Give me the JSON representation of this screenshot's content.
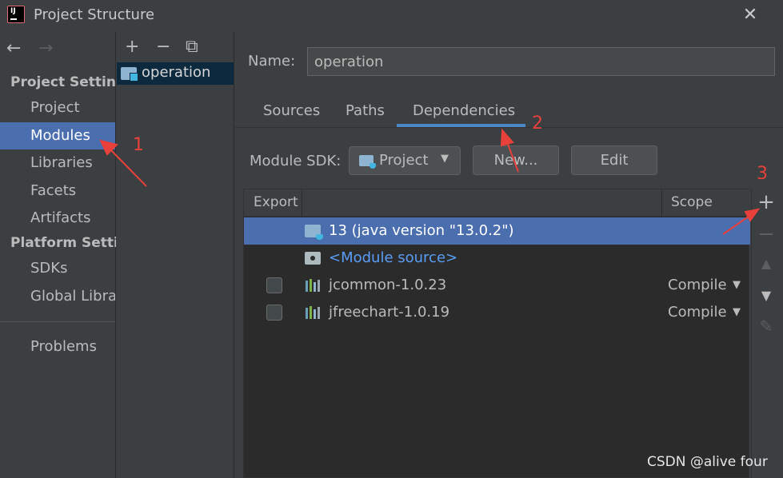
{
  "window": {
    "title": "Project Structure",
    "close_glyph": "✕"
  },
  "sidebar": {
    "back_glyph": "←",
    "forward_glyph": "→",
    "sections": [
      {
        "heading": "Project Settings",
        "items": [
          "Project",
          "Modules",
          "Libraries",
          "Facets",
          "Artifacts"
        ]
      },
      {
        "heading": "Platform Settings",
        "items": [
          "SDKs",
          "Global Libraries"
        ]
      }
    ],
    "selected": "Modules",
    "problems": "Problems"
  },
  "modules": {
    "toolbar": {
      "add_glyph": "+",
      "remove_glyph": "−",
      "copy_glyph": "⧉"
    },
    "items": [
      {
        "name": "operation",
        "selected": true
      }
    ]
  },
  "main": {
    "name_label": "Name:",
    "name_value": "operation",
    "tabs": [
      {
        "label": "Sources",
        "active": false
      },
      {
        "label": "Paths",
        "active": false
      },
      {
        "label": "Dependencies",
        "active": true
      }
    ],
    "sdk_label": "Module SDK:",
    "sdk_value": "Project SDK",
    "new_button": "New...",
    "edit_button": "Edit",
    "table": {
      "headers": {
        "export": "Export",
        "scope": "Scope"
      },
      "rows": [
        {
          "name": "13 (java version \"13.0.2\")",
          "icon": "jdk-folder-icon",
          "checkbox": false,
          "scope": "",
          "selected": true
        },
        {
          "name": "<Module source>",
          "icon": "source-folder-icon",
          "checkbox": false,
          "scope": "",
          "selected": false,
          "link": true
        },
        {
          "name": "jcommon-1.0.23",
          "icon": "library-icon",
          "checkbox": true,
          "scope": "Compile",
          "selected": false
        },
        {
          "name": "jfreechart-1.0.19",
          "icon": "library-icon",
          "checkbox": true,
          "scope": "Compile",
          "selected": false
        }
      ]
    },
    "right_toolbar": {
      "add": "+",
      "remove": "−",
      "up": "▲",
      "down": "▼",
      "edit": "✎"
    }
  },
  "annotations": {
    "numbers": [
      "1",
      "2",
      "3"
    ],
    "color": "#e8403a"
  },
  "watermark": "CSDN @alive four",
  "colors": {
    "background": "#3c3f41",
    "selection": "#4b6eaf",
    "tab_underline": "#4a88c7",
    "link": "#589df6"
  }
}
